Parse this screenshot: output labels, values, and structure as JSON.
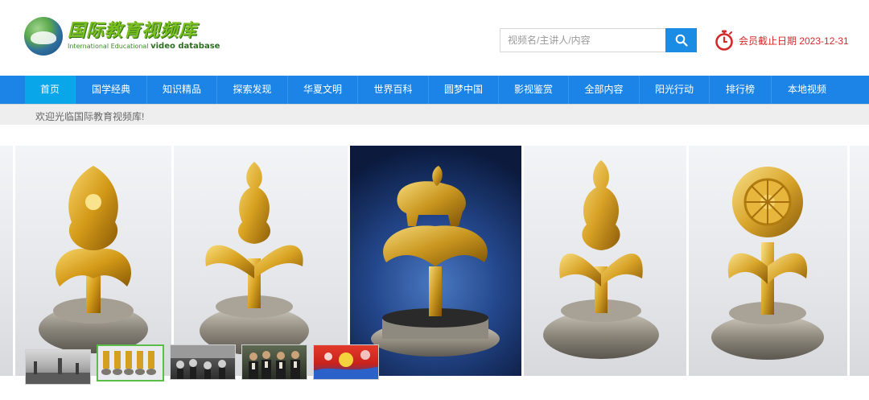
{
  "header": {
    "logo": {
      "cn": "国际教育视频库",
      "en_small": "International Educational",
      "en_big": "video database"
    },
    "search": {
      "placeholder": "视频名/主讲人/内容",
      "icon": "search-icon"
    },
    "expiry": {
      "icon": "stopwatch-icon",
      "text": "会员截止日期 2023-12-31"
    }
  },
  "nav": {
    "items": [
      {
        "label": "首页",
        "active": true
      },
      {
        "label": "国学经典"
      },
      {
        "label": "知识精品"
      },
      {
        "label": "探索发现"
      },
      {
        "label": "华夏文明"
      },
      {
        "label": "世界百科"
      },
      {
        "label": "圆梦中国"
      },
      {
        "label": "影视鉴赏"
      },
      {
        "label": "全部内容"
      },
      {
        "label": "阳光行动"
      },
      {
        "label": "排行榜"
      },
      {
        "label": "本地视频"
      }
    ]
  },
  "welcome": {
    "text": "欢迎光临国际教育视频库!"
  },
  "banner": {
    "slides": [
      "gilt-bronze-ritual-ornament",
      "gilt-bronze-seated-figure",
      "gilt-bronze-elephant-ornament",
      "gilt-bronze-seated-deity",
      "gilt-bronze-dharma-wheel"
    ],
    "thumbnails": [
      {
        "name": "thumb-historical-photo"
      },
      {
        "name": "thumb-bronze-ornaments",
        "selected": true
      },
      {
        "name": "thumb-crowd-scene"
      },
      {
        "name": "thumb-group-portrait"
      },
      {
        "name": "thumb-animation-scene"
      }
    ]
  },
  "colors": {
    "nav_bg": "#1b84e6",
    "nav_active": "#0aa6ea",
    "search_button": "#1a8ce3",
    "expiry_red": "#d42a2a",
    "thumb_selected_border": "#5cbd4a"
  }
}
